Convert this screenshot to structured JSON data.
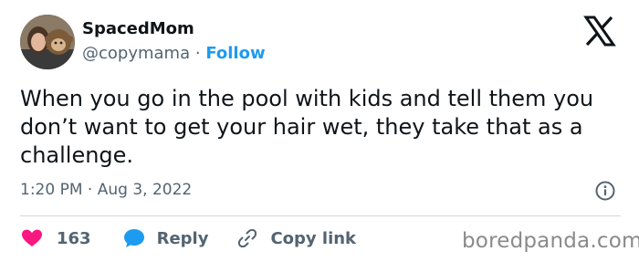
{
  "author": {
    "display_name": "SpacedMom",
    "handle": "@copymama",
    "separator": "·",
    "follow_label": "Follow"
  },
  "tweet": {
    "text": "When you go in the pool with kids and tell them you don’t want to get your hair wet, they take that as a challenge.",
    "time": "1:20 PM",
    "date": "Aug 3, 2022",
    "meta_separator": "·"
  },
  "actions": {
    "like_count": "163",
    "reply_label": "Reply",
    "copy_link_label": "Copy link"
  },
  "watermark": "boredpanda.com",
  "colors": {
    "like": "#f91880",
    "reply": "#1d9bf0",
    "follow": "#1d9bf0",
    "muted": "#536471"
  },
  "icons": {
    "brand": "x-logo-icon",
    "info": "info-icon",
    "like": "heart-icon",
    "reply": "speech-bubble-icon",
    "copy": "link-icon"
  }
}
